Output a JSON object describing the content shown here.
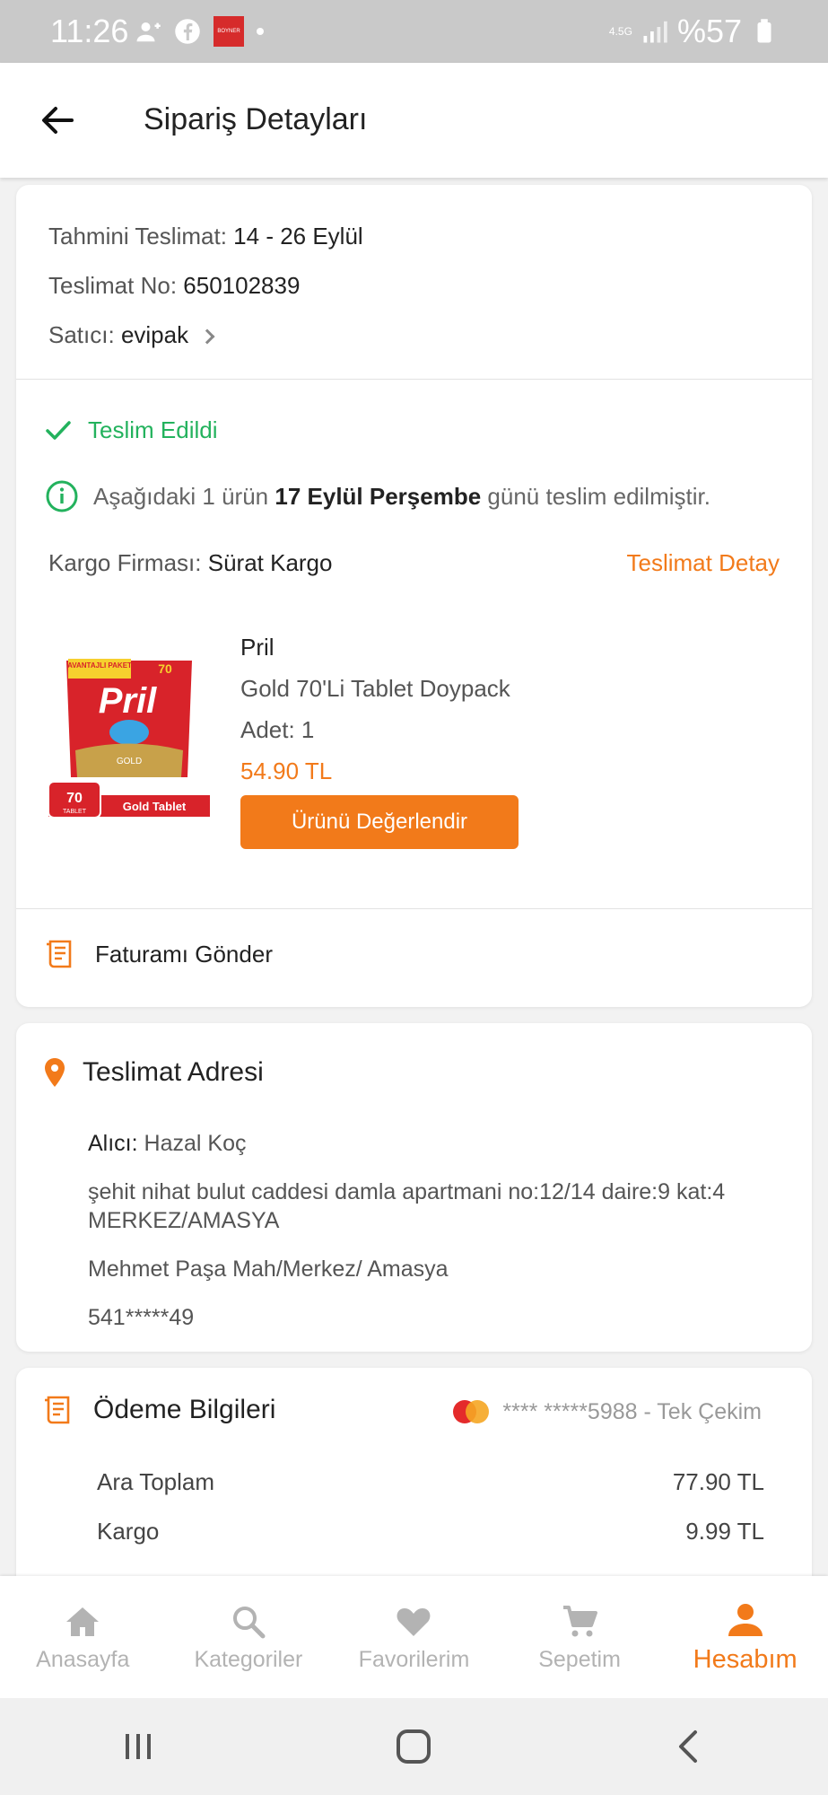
{
  "status_bar": {
    "time": "11:26",
    "network": "4.5G",
    "battery": "%57",
    "brand_icon_text": "BOYNER"
  },
  "header": {
    "title": "Sipariş Detayları"
  },
  "order": {
    "delivery_label": "Tahmini Teslimat:",
    "delivery_value": "14 - 26 Eylül",
    "no_label": "Teslimat No:",
    "no_value": "650102839",
    "seller_label": "Satıcı:",
    "seller_value": "evipak",
    "status": "Teslim Edildi",
    "info_prefix": "Aşağıdaki 1 ürün",
    "info_date": "17 Eylül Perşembe",
    "info_suffix": "günü teslim edilmiştir.",
    "cargo_label": "Kargo Firması:",
    "cargo_value": "Sürat Kargo",
    "cargo_link": "Teslimat Detay"
  },
  "product": {
    "brand": "Pril",
    "name": "Gold 70'Li Tablet Doypack",
    "quantity": "Adet: 1",
    "price": "54.90 TL",
    "rate_button": "Ürünü Değerlendir",
    "image_texts": {
      "top": "AVANTAJLI PAKET",
      "count": "70",
      "brand": "Pril",
      "variant": "GOLD",
      "badge_number": "70",
      "badge_unit": "TABLET",
      "badge_label": "Gold Tablet"
    }
  },
  "invoice": {
    "label": "Faturamı Gönder"
  },
  "address": {
    "title": "Teslimat Adresi",
    "recipient_label": "Alıcı:",
    "recipient_value": "Hazal  Koç",
    "street": "şehit nihat bulut caddesi damla apartmani no:12/14 daire:9 kat:4 MERKEZ/AMASYA",
    "district": "Mehmet Paşa Mah/Merkez/ Amasya",
    "phone": "541*****49"
  },
  "payment": {
    "title": "Ödeme Bilgileri",
    "card": "**** *****5988 - Tek Çekim",
    "subtotal_label": "Ara Toplam",
    "subtotal_value": "77.90 TL",
    "shipping_label": "Kargo",
    "shipping_value": "9.99 TL"
  },
  "nav": {
    "items": [
      {
        "label": "Anasayfa",
        "icon": "home-icon"
      },
      {
        "label": "Kategoriler",
        "icon": "search-icon"
      },
      {
        "label": "Favorilerim",
        "icon": "heart-icon"
      },
      {
        "label": "Sepetim",
        "icon": "cart-icon"
      },
      {
        "label": "Hesabım",
        "icon": "person-icon"
      }
    ],
    "active_index": 4
  },
  "colors": {
    "accent": "#f27a1a",
    "success": "#23b25d",
    "status_bar": "#c9c9c9"
  }
}
